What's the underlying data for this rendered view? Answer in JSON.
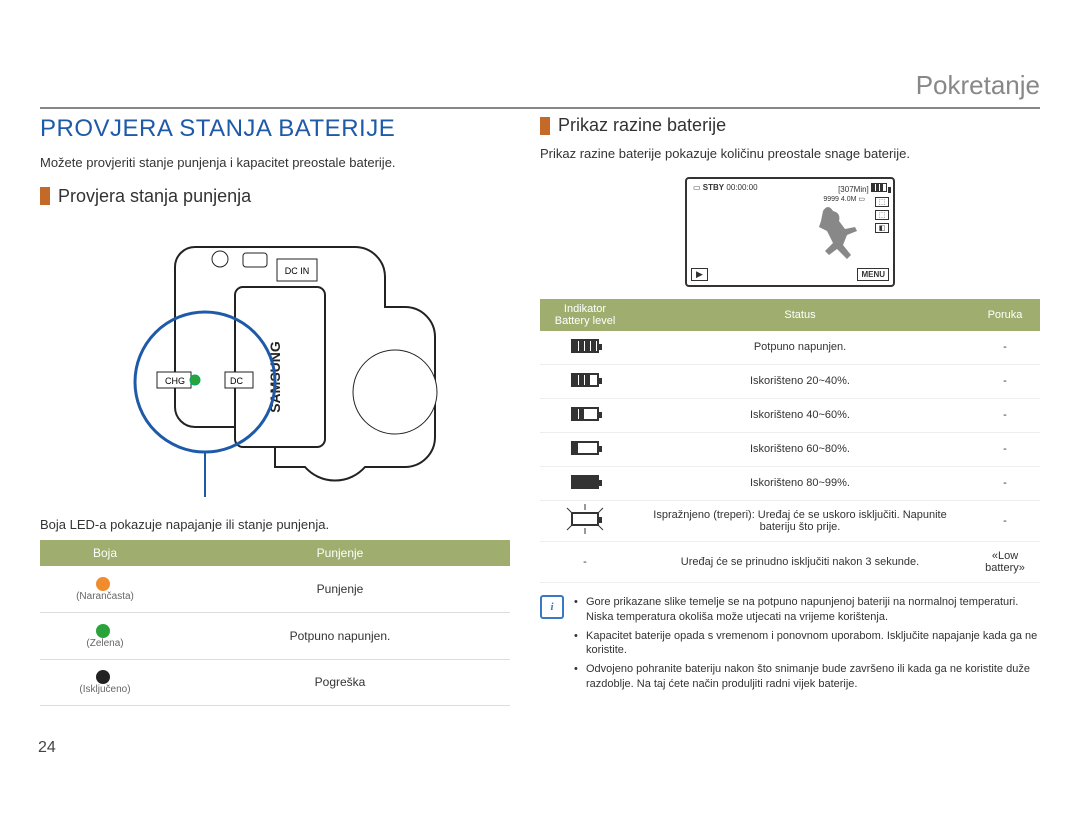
{
  "breadcrumb": "Pokretanje",
  "page_number": "24",
  "left": {
    "title": "PROVJERA STANJA BATERIJE",
    "desc": "Možete provjeriti stanje punjenja i kapacitet preostale baterije.",
    "sub": "Provjera stanja punjenja",
    "led_caption": "Boja LED-a pokazuje napajanje ili stanje punjenja.",
    "led_table": {
      "headers": [
        "Boja",
        "Punjenje"
      ],
      "rows": [
        {
          "color_label": "(Narančasta)",
          "state": "Punjenje"
        },
        {
          "color_label": "(Zelena)",
          "state": "Potpuno napunjen."
        },
        {
          "color_label": "(Isključeno)",
          "state": "Pogreška"
        }
      ]
    }
  },
  "right": {
    "sub": "Prikaz razine baterije",
    "desc": "Prikaz razine baterije pokazuje količinu preostale snage baterije.",
    "lcd": {
      "stby": "STBY",
      "time": "00:00:00",
      "remain": "[307Min]",
      "res": "9999",
      "mp": "4.0M",
      "menu": "MENU",
      "play": "▶"
    },
    "batt_table": {
      "headers": [
        "Indikator\nBattery level",
        "Status",
        "Poruka"
      ],
      "rows": [
        {
          "bars": 4,
          "status": "Potpuno napunjen.",
          "msg": "-"
        },
        {
          "bars": 3,
          "status": "Iskorišteno 20~40%.",
          "msg": "-"
        },
        {
          "bars": 2,
          "status": "Iskorišteno 40~60%.",
          "msg": "-"
        },
        {
          "bars": 1,
          "status": "Iskorišteno 60~80%.",
          "msg": "-"
        },
        {
          "bars": 0,
          "solid": true,
          "status": "Iskorišteno 80~99%.",
          "msg": "-"
        },
        {
          "bars": 0,
          "flash": true,
          "status": "Ispražnjeno (treperi): Uređaj će se uskoro isključiti. Napunite bateriju što prije.",
          "msg": "-"
        },
        {
          "bars": -1,
          "status": "Uređaj će se prinudno isključiti nakon 3 sekunde.",
          "msg": "«Low battery»"
        }
      ]
    },
    "notes": [
      "Gore prikazane slike temelje se na potpuno napunjenoj bateriji na normalnoj temperaturi. Niska temperatura okoliša može utjecati na vrijeme korištenja.",
      "Kapacitet baterije opada s vremenom i ponovnom uporabom. Isključite napajanje kada ga ne koristite.",
      "Odvojeno pohranite bateriju nakon što snimanje bude završeno ili kada ga ne koristite duže razdoblje. Na taj ćete način produljiti radni vijek baterije."
    ]
  }
}
